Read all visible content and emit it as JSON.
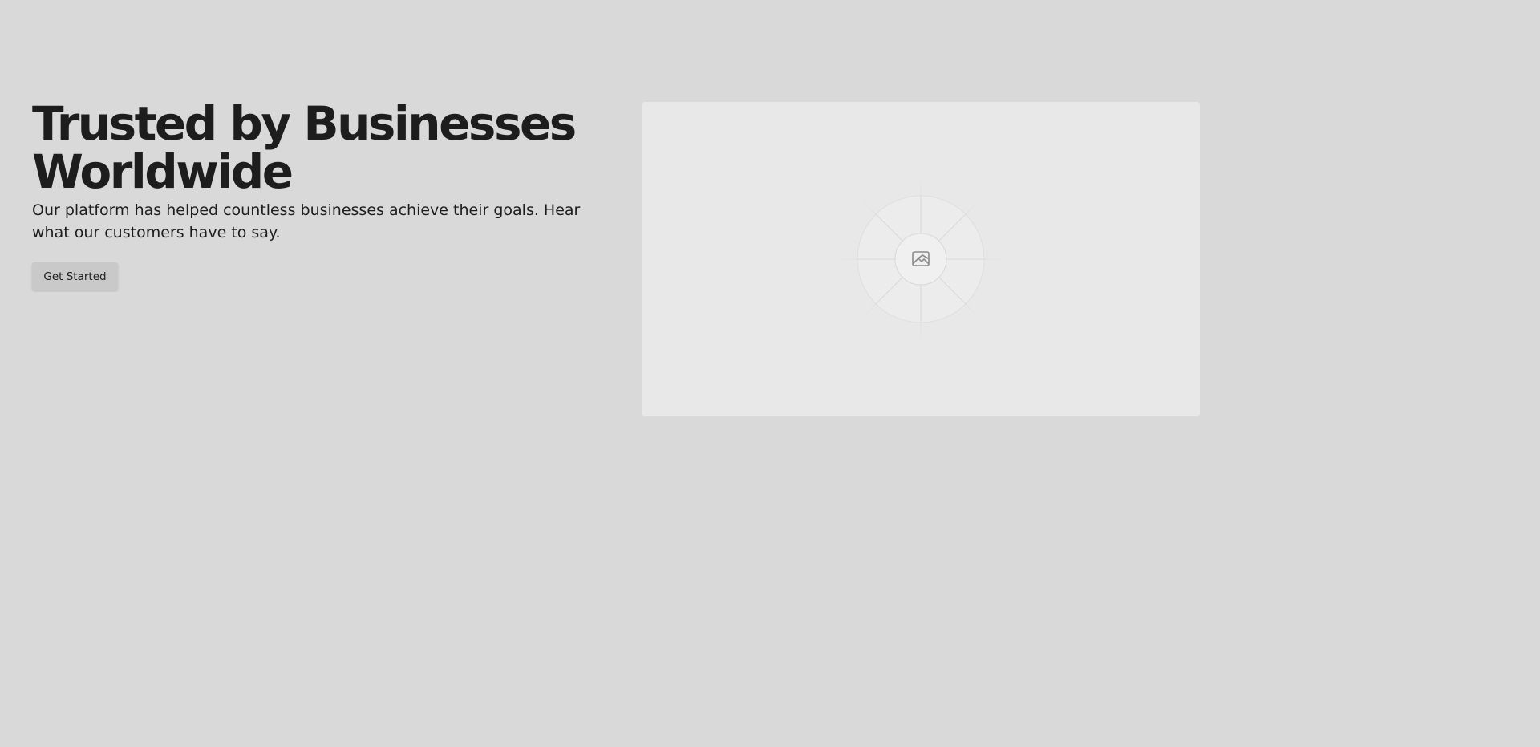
{
  "hero": {
    "title": "Trusted by Businesses\nWorldwide",
    "subtitle": "Our platform has helped countless businesses achieve their goals. Hear what our customers have to say.",
    "cta_label": "Get Started"
  },
  "media": {
    "icon": "image-icon"
  },
  "colors": {
    "background": "#d9d9d9",
    "text": "#1d1d1d",
    "button_bg": "#c9c9c9",
    "placeholder_bg": "#e8e8e8"
  }
}
